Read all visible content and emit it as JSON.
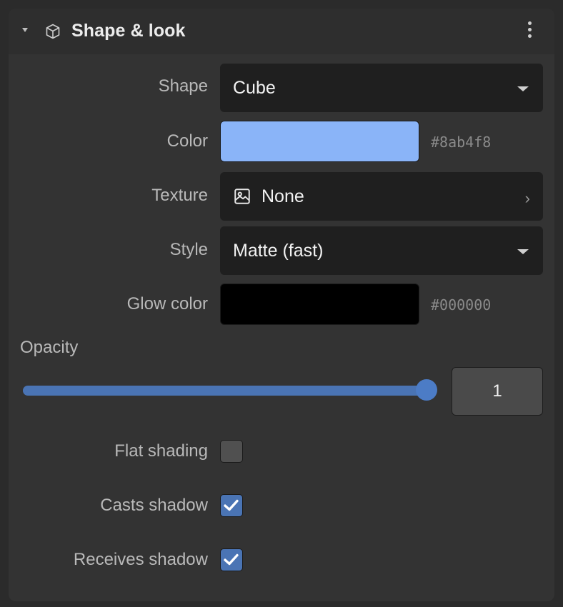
{
  "section": {
    "title": "Shape & look",
    "icon": "cube-icon",
    "menu_icon": "more-vertical-icon"
  },
  "fields": {
    "shape": {
      "label": "Shape",
      "value": "Cube"
    },
    "color": {
      "label": "Color",
      "hex": "#8ab4f8",
      "swatch": "#8ab4f8"
    },
    "texture": {
      "label": "Texture",
      "value": "None",
      "icon": "image-icon"
    },
    "style": {
      "label": "Style",
      "value": "Matte (fast)"
    },
    "glow_color": {
      "label": "Glow color",
      "hex": "#000000",
      "swatch": "#000000"
    },
    "opacity": {
      "label": "Opacity",
      "value": "1",
      "fraction": 1.0
    },
    "flat_shading": {
      "label": "Flat shading",
      "checked": false
    },
    "casts_shadow": {
      "label": "Casts shadow",
      "checked": true
    },
    "receives_shadow": {
      "label": "Receives shadow",
      "checked": true
    }
  }
}
